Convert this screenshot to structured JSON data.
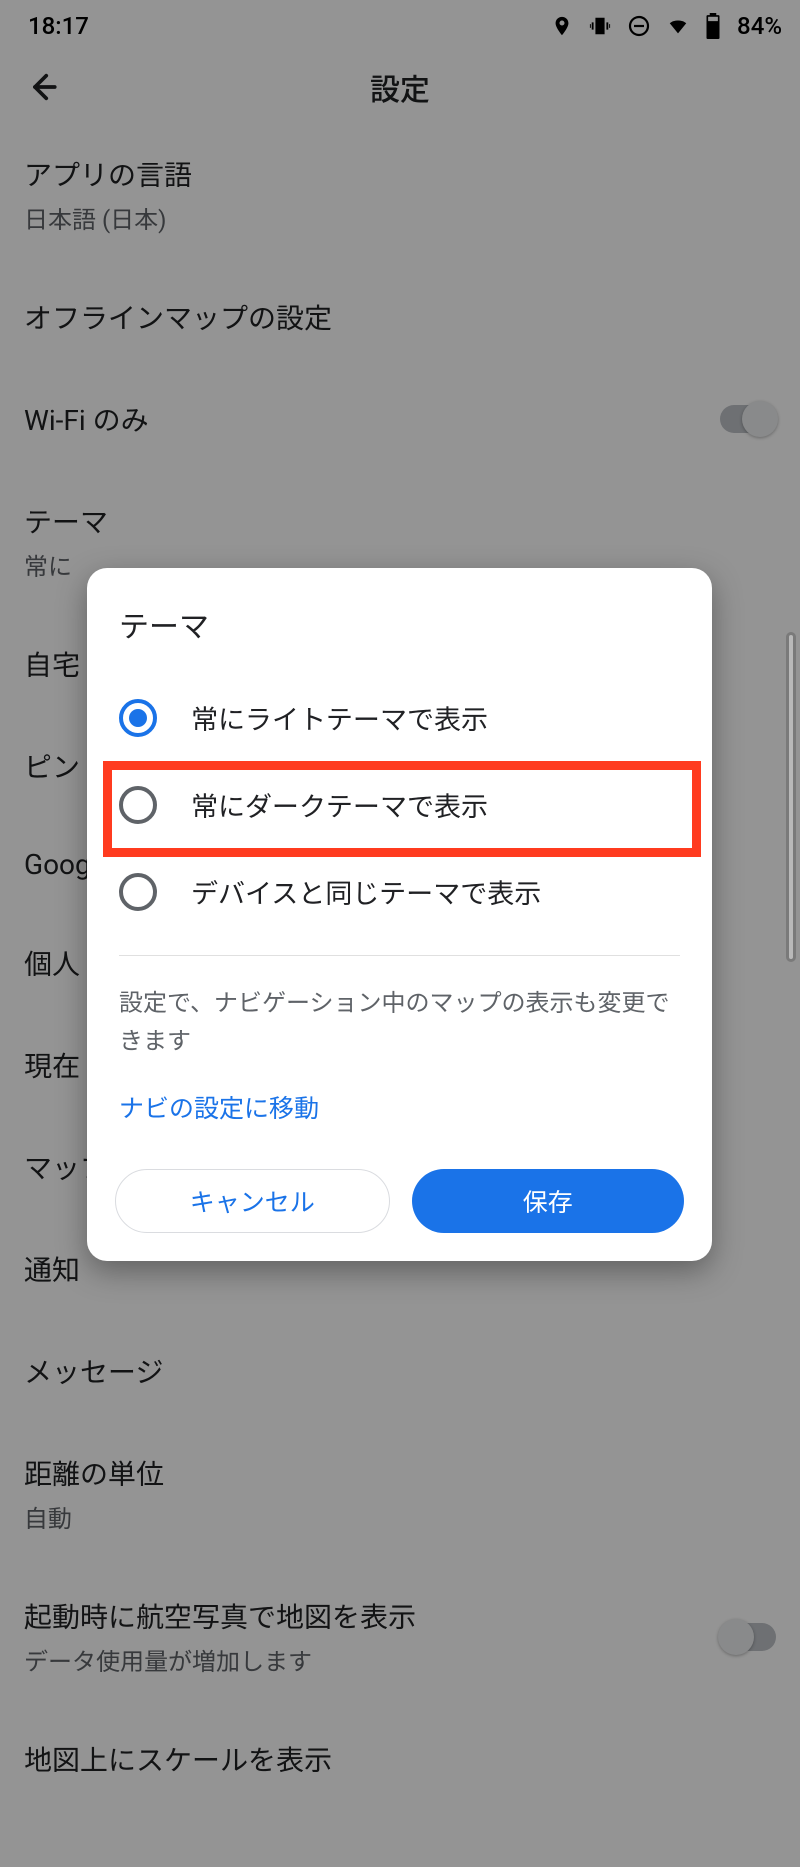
{
  "status": {
    "time": "18:17",
    "battery": "84%"
  },
  "header": {
    "title": "設定"
  },
  "settings": {
    "app_language": {
      "label": "アプリの言語",
      "value": "日本語 (日本)"
    },
    "offline_map": {
      "label": "オフラインマップの設定"
    },
    "wifi_only": {
      "label": "Wi-Fi のみ"
    },
    "theme": {
      "label": "テーマ",
      "value": "常に"
    },
    "home": {
      "label": "自宅"
    },
    "pin": {
      "label": "ピン"
    },
    "google": {
      "label": "Google"
    },
    "personal": {
      "label": "個人"
    },
    "current": {
      "label": "現在"
    },
    "map": {
      "label": "マップ"
    },
    "notifications": {
      "label": "通知"
    },
    "messages": {
      "label": "メッセージ"
    },
    "distance": {
      "label": "距離の単位",
      "value": "自動"
    },
    "aerial": {
      "label": "起動時に航空写真で地図を表示",
      "note": "データ使用量が増加します"
    },
    "scale": {
      "label": "地図上にスケールを表示"
    }
  },
  "dialog": {
    "title": "テーマ",
    "options": [
      "常にライトテーマで表示",
      "常にダークテーマで表示",
      "デバイスと同じテーマで表示"
    ],
    "selected_index": 0,
    "highlighted_index": 1,
    "note": "設定で、ナビゲーション中のマップの表示も変更できます",
    "nav_link": "ナビの設定に移動",
    "cancel": "キャンセル",
    "save": "保存"
  }
}
